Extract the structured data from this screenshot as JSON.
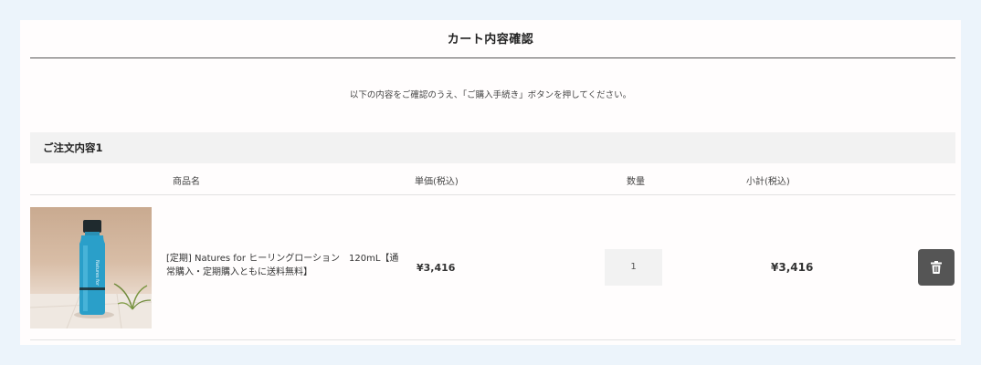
{
  "page": {
    "title": "カート内容確認",
    "instruction": "以下の内容をご確認のうえ、「ご購入手続き」ボタンを押してください。"
  },
  "order": {
    "section_title": "ご注文内容1",
    "columns": {
      "name": "商品名",
      "price": "単価(税込)",
      "quantity": "数量",
      "subtotal": "小計(税込)"
    },
    "items": [
      {
        "name": "[定期] Natures for ヒーリングローション　120mL【通常購入・定期購入ともに送料無料】",
        "price": "¥3,416",
        "quantity": "1",
        "subtotal": "¥3,416",
        "image_icon": "product-bottle-image",
        "delete_icon": "trash-icon"
      }
    ]
  },
  "colors": {
    "background": "#ecf4fb",
    "panel": "#fffdfd",
    "section_bar": "#f2f2f2",
    "delete_button": "#555555",
    "bottle": "#2a9fc9"
  }
}
